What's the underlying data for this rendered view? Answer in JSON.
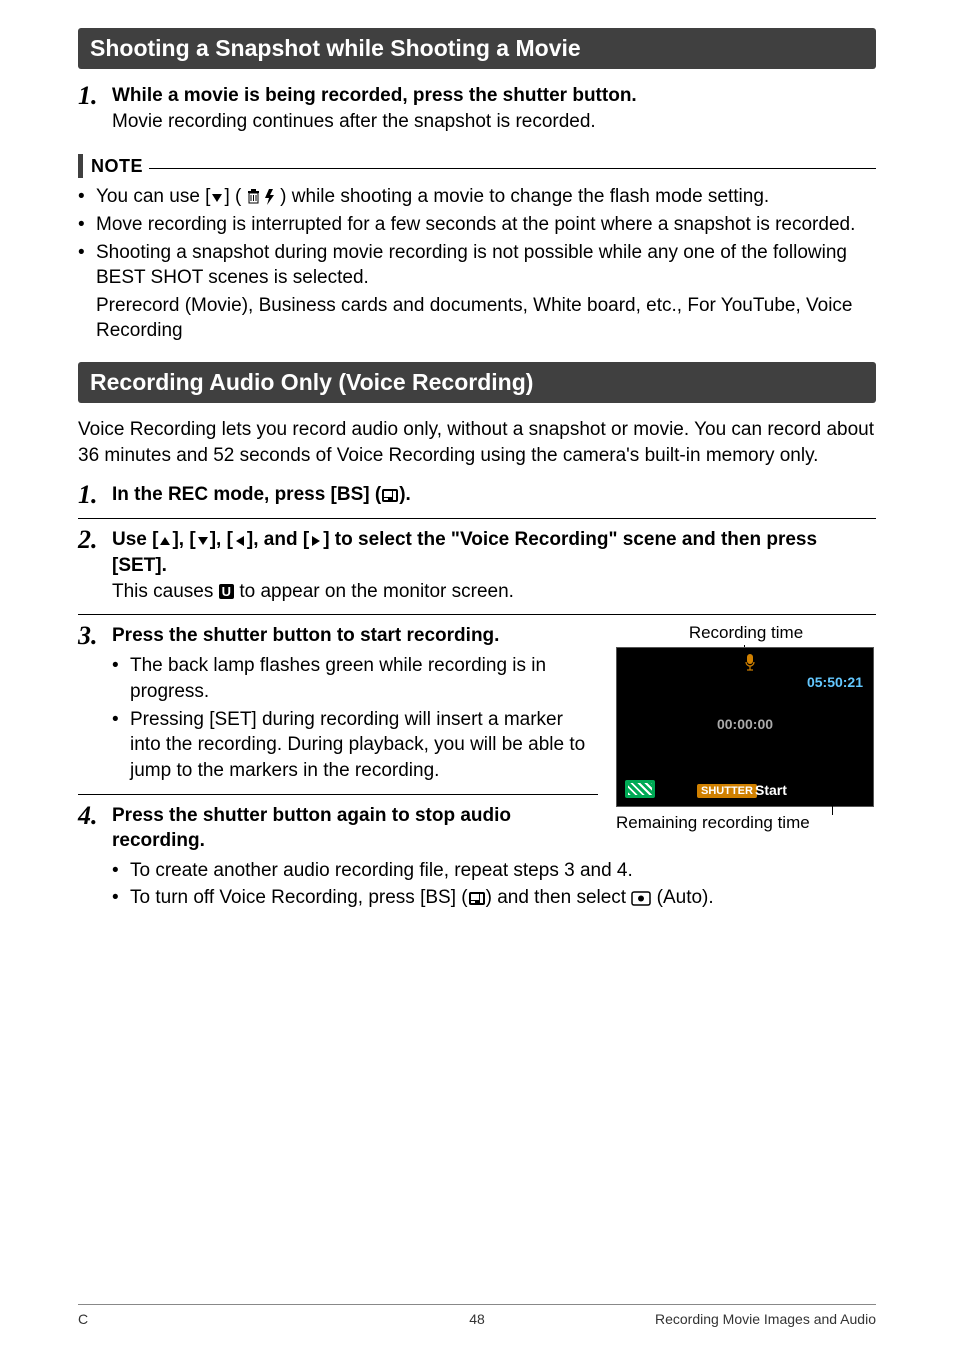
{
  "section1": {
    "title": "Shooting a Snapshot while Shooting a Movie",
    "step1_bold": "While a movie is being recorded, press the shutter button.",
    "step1_sub": "Movie recording continues after the snapshot is recorded.",
    "note_label": "NOTE",
    "bullet1_a": "You can use [",
    "bullet1_b": "] ( ",
    "bullet1_c": " ) while shooting a movie to change the flash mode setting.",
    "bullet2": "Move recording is interrupted for a few seconds at the point where a snapshot is recorded.",
    "bullet3": "Shooting a snapshot during movie recording is not possible while any one of the following BEST SHOT scenes is selected.",
    "bullet3_sub": "Prerecord (Movie), Business cards and documents, White board, etc., For YouTube, Voice Recording"
  },
  "section2": {
    "title": "Recording Audio Only (Voice Recording)",
    "intro": "Voice Recording lets you record audio only, without a snapshot or movie. You can record about 36 minutes and 52 seconds of Voice Recording using the camera's built-in memory only.",
    "step1": "In the REC mode, press [BS] (",
    "step1_end": ").",
    "step2_a": "Use [",
    "step2_b": "], [",
    "step2_c": "], [",
    "step2_d": "], and [",
    "step2_e": "] to select the \"Voice Recording\" scene and then press [SET].",
    "step2_sub_a": "This causes ",
    "step2_sub_b": " to appear on the monitor screen.",
    "step3": "Press the shutter button to start recording.",
    "step3_b1": "The back lamp flashes green while recording is in progress.",
    "step3_b2": "Pressing [SET] during recording will insert a marker into the recording. During playback, you will be able to jump to the markers in the recording.",
    "step4": "Press the shutter button again to stop audio recording.",
    "step4_b1": "To create another audio recording file, repeat steps 3 and 4.",
    "step4_b2_a": "To turn off Voice Recording, press [BS] (",
    "step4_b2_b": ") and then select ",
    "step4_b2_c": " (Auto).",
    "screenshot": {
      "rec_label": "Recording time",
      "rem_label": "Remaining recording time",
      "rectime": "05:50:21",
      "elapsed": "00:00:00",
      "shutter": "SHUTTER",
      "start": "Start"
    }
  },
  "chip_u": "U",
  "footer": {
    "left": "C",
    "page": "48",
    "right": "Recording Movie Images and Audio"
  },
  "nums": {
    "n1": "1.",
    "n2": "2.",
    "n3": "3.",
    "n4": "4."
  }
}
